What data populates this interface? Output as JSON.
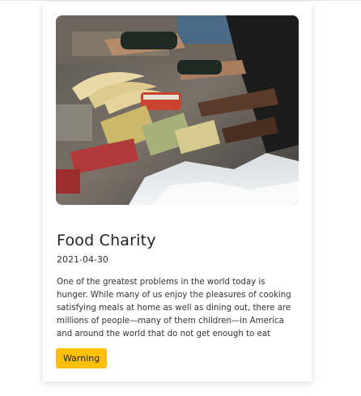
{
  "card": {
    "title": "Food Charity",
    "date": "2021-04-30",
    "description": "One of the greatest problems in the world today is hunger. While many of us enjoy the pleasures of cooking satisfying meals at home as well as dining out, there are millions of people—many of them children—in America and around the world that do not get enough to eat",
    "badge_label": "Warning",
    "image_icon": "photo-food-donation-sorting",
    "colors": {
      "badge": "#ffc107",
      "title_text": "#222222",
      "body_text": "#333333"
    }
  }
}
